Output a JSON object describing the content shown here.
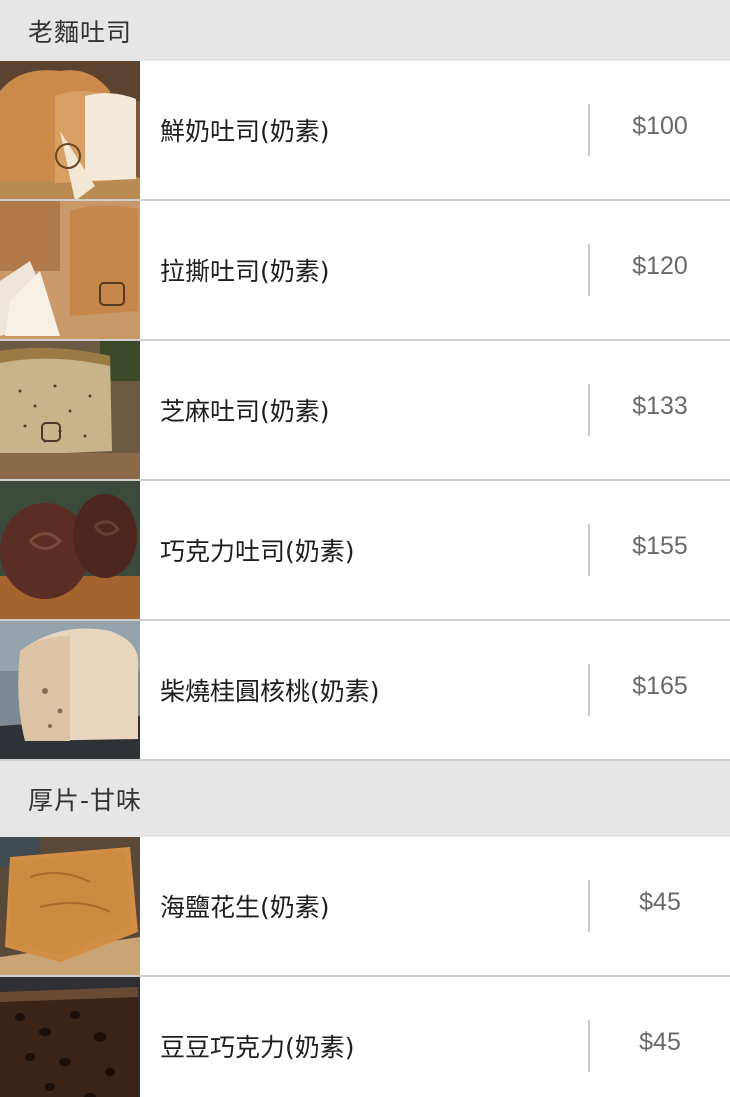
{
  "sections": [
    {
      "title": "老麵吐司",
      "items": [
        {
          "name": "鮮奶吐司(奶素)",
          "price": "$100",
          "image": "fresh-milk-toast-image"
        },
        {
          "name": "拉撕吐司(奶素)",
          "price": "$120",
          "image": "pull-apart-toast-image"
        },
        {
          "name": "芝麻吐司(奶素)",
          "price": "$133",
          "image": "sesame-toast-image"
        },
        {
          "name": "巧克力吐司(奶素)",
          "price": "$155",
          "image": "chocolate-toast-image"
        },
        {
          "name": "柴燒桂圓核桃(奶素)",
          "price": "$165",
          "image": "longan-walnut-toast-image"
        }
      ]
    },
    {
      "title": "厚片-甘味",
      "items": [
        {
          "name": "海鹽花生(奶素)",
          "price": "$45",
          "image": "sea-salt-peanut-thick-toast-image"
        },
        {
          "name": "豆豆巧克力(奶素)",
          "price": "$45",
          "image": "chocolate-chip-thick-toast-image"
        }
      ]
    }
  ],
  "colors": {
    "section_bg": "#e6e6e6",
    "divider": "#cfcfcf",
    "price_text": "#6a6a6a"
  }
}
